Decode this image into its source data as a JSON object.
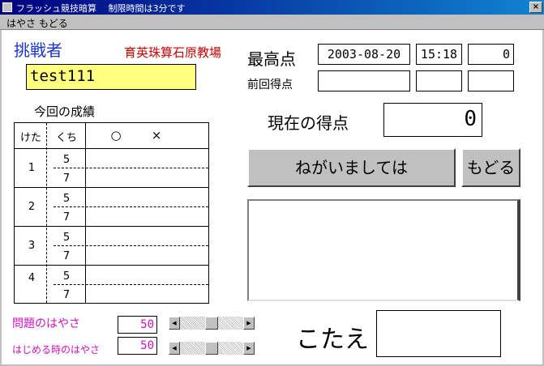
{
  "window": {
    "title": "フラッシュ競技暗算　 制限時間は3分です",
    "close_glyph": "×"
  },
  "menu": {
    "items": [
      "はやさ",
      "もどる"
    ]
  },
  "challenger": {
    "label": "挑戦者",
    "name": "test111"
  },
  "school": "育英珠算石原教場",
  "high_score": {
    "label": "最高点",
    "date": "2003-08-20",
    "time": "15:18",
    "score": "0"
  },
  "previous_score": {
    "label": "前回得点",
    "date": "",
    "time": "",
    "score": ""
  },
  "results": {
    "label": "今回の成績",
    "headers": {
      "digits": "けた",
      "count": "くち",
      "correct": "○",
      "wrong": "×"
    },
    "rows": [
      {
        "digits": "1",
        "count_top": "5",
        "count_bottom": "7"
      },
      {
        "digits": "2",
        "count_top": "5",
        "count_bottom": "7"
      },
      {
        "digits": "3",
        "count_top": "5",
        "count_bottom": "7"
      },
      {
        "digits": "4",
        "count_top": "5",
        "count_bottom": "7"
      }
    ]
  },
  "current_score": {
    "label": "現在の得点",
    "value": "0"
  },
  "buttons": {
    "start": "ねがいましては",
    "back": "もどる"
  },
  "speed": {
    "question_label": "問題のはやさ",
    "question_value": "50",
    "start_label": "はじめる時のはやさ",
    "start_value": "50",
    "question_level": 0.5,
    "start_level": 0.5
  },
  "answer": {
    "label": "こたえ",
    "value": ""
  },
  "colors": {
    "title_bar": "#000080",
    "accent_blue": "#1a35c8",
    "accent_red": "#cc0000",
    "accent_magenta": "#d010c0",
    "name_field": "#ffff80",
    "panel_gray": "#c0c0c0"
  }
}
